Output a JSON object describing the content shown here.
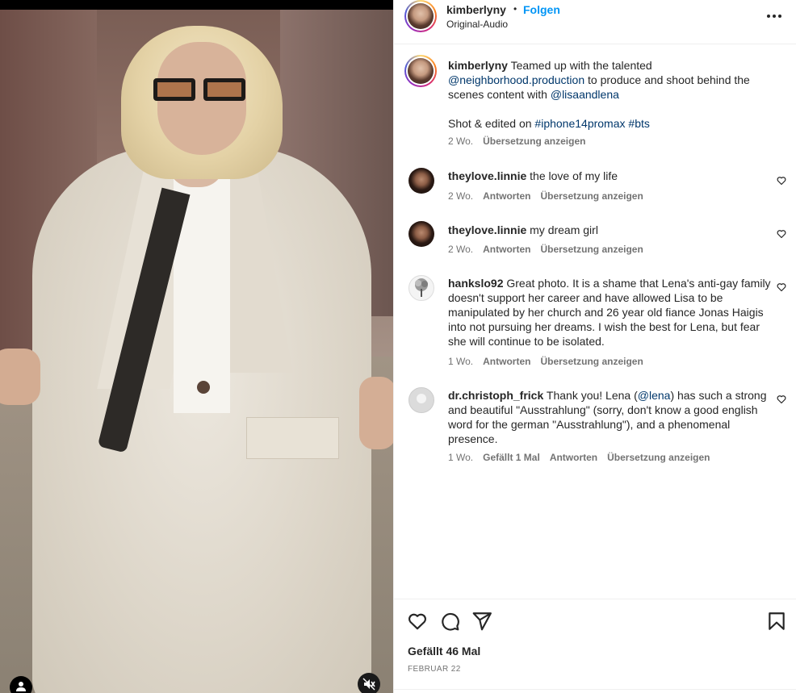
{
  "post": {
    "username": "kimberlyny",
    "separator": "•",
    "follow_label": "Folgen",
    "audio_label": "Original-Audio"
  },
  "caption": {
    "username": "kimberlyny",
    "text_1": " Teamed up with the talented ",
    "mention_1": "@neighborhood.production",
    "text_2": " to produce and shoot behind the scenes content with ",
    "mention_2": "@lisaandlena",
    "text_3": "Shot & edited on ",
    "hashtag_1": "#iphone14promax",
    "text_4": " ",
    "hashtag_2": "#bts",
    "time": "2 Wo.",
    "translate": "Übersetzung anzeigen"
  },
  "comments": [
    {
      "username": "theylove.linnie",
      "text": " the love of my life",
      "time": "2 Wo.",
      "reply": "Antworten",
      "translate": "Übersetzung anzeigen"
    },
    {
      "username": "theylove.linnie",
      "text": " my dream girl",
      "time": "2 Wo.",
      "reply": "Antworten",
      "translate": "Übersetzung anzeigen"
    },
    {
      "username": "hankslo92",
      "text": " Great photo. It is a shame that Lena's anti-gay family doesn't support her career and have allowed Lisa to be manipulated by her church and 26 year old fiance Jonas Haigis into not pursuing her dreams. I wish the best for Lena, but fear she will continue to be isolated.",
      "time": "1 Wo.",
      "reply": "Antworten",
      "translate": "Übersetzung anzeigen"
    },
    {
      "username": "dr.christoph_frick",
      "text_a": " Thank you! Lena (",
      "mention": "@lena",
      "text_b": ") has such a strong and beautiful \"Ausstrahlung\" (sorry, don't know a good english word for the german \"Ausstrahlung\"), and a phenomenal presence.",
      "time": "1 Wo.",
      "likes": "Gefällt 1 Mal",
      "reply": "Antworten",
      "translate": "Übersetzung anzeigen"
    }
  ],
  "footer": {
    "likes": "Gefällt 46 Mal",
    "date": "FEBRUAR 22"
  },
  "colors": {
    "accent": "#0095f6",
    "link": "#00376b",
    "text": "#262626",
    "muted": "#737373"
  },
  "icons": [
    "heart-icon",
    "comment-icon",
    "share-icon",
    "bookmark-icon",
    "more-icon",
    "mute-icon",
    "user-tag-icon"
  ]
}
